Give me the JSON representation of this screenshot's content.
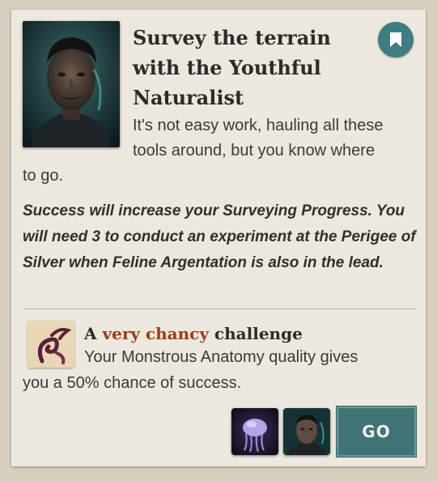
{
  "storylet": {
    "title": "Survey the terrain with the Youthful Naturalist",
    "description_line1": "It's not easy work, hauling all these tools around, but you know where",
    "description_line2": "to go.",
    "instructions": "Success will increase your Surveying Progress. You will need 3 to conduct an experiment at the Perigee of Silver when Feline Argentation is also in the lead.",
    "portrait_icon": "youthful-naturalist-portrait",
    "bookmark_icon": "bookmark-icon"
  },
  "challenge": {
    "prefix": "A",
    "difficulty": "very chancy",
    "suffix": "challenge",
    "description_line1": "Your Monstrous Anatomy quality gives",
    "description_line2": "you a 50% chance of success.",
    "quality_icon": "monstrous-anatomy-icon"
  },
  "requirements": [
    {
      "icon": "jellyfish-icon"
    },
    {
      "icon": "naturalist-portrait-icon"
    }
  ],
  "go_button": {
    "label": "GO"
  },
  "colors": {
    "background": "#d6cfbe",
    "card": "#ede8de",
    "accent": "#3f7d80",
    "chancy": "#a13a14",
    "go_button": "#3f7375"
  }
}
